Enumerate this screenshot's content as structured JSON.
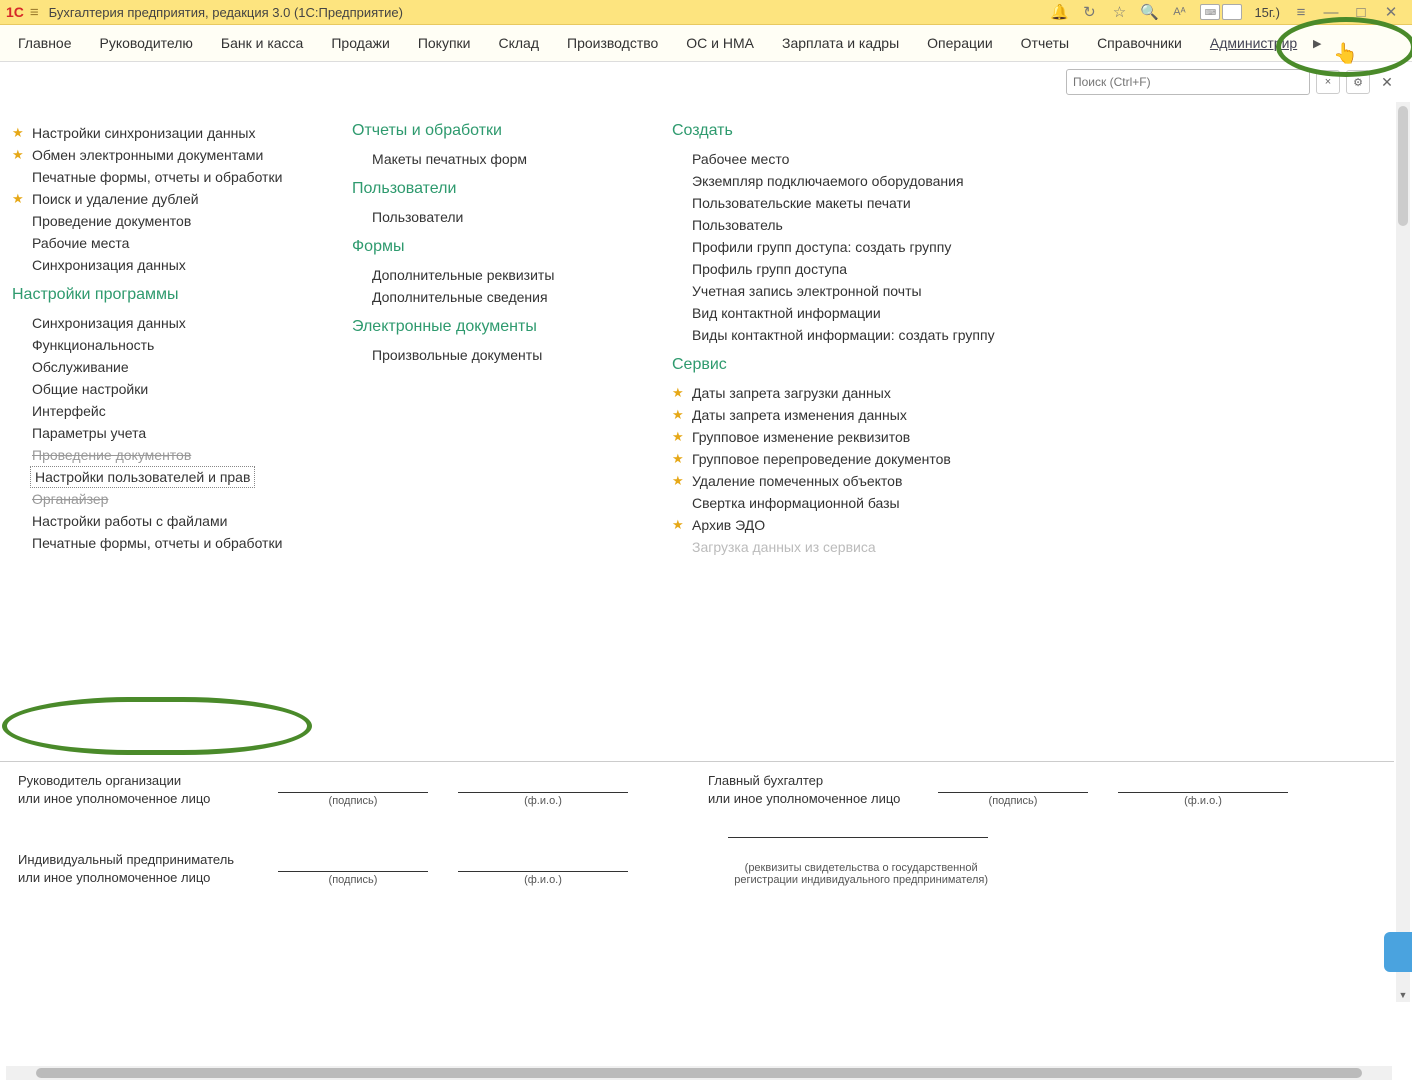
{
  "titlebar": {
    "logo": "1C",
    "title": "Бухгалтерия предприятия, редакция 3.0  (1С:Предприятие)",
    "cut_text": "15г.)"
  },
  "nav": {
    "items": [
      "Главное",
      "Руководителю",
      "Банк и касса",
      "Продажи",
      "Покупки",
      "Склад",
      "Производство",
      "ОС и НМА",
      "Зарплата и кадры",
      "Операции",
      "Отчеты",
      "Справочники"
    ],
    "last": "Администрир"
  },
  "search": {
    "placeholder": "Поиск (Ctrl+F)"
  },
  "columns": {
    "col1": {
      "top_items": [
        {
          "label": "Настройки синхронизации данных",
          "star": true
        },
        {
          "label": "Обмен электронными документами",
          "star": true
        },
        {
          "label": "Печатные формы, отчеты и обработки",
          "star": false
        },
        {
          "label": "Поиск и удаление дублей",
          "star": true
        },
        {
          "label": "Проведение документов",
          "star": false
        },
        {
          "label": "Рабочие места",
          "star": false
        },
        {
          "label": "Синхронизация данных",
          "star": false
        }
      ],
      "group1_title": "Настройки программы",
      "group1_items": [
        {
          "label": "Синхронизация данных"
        },
        {
          "label": "Функциональность"
        },
        {
          "label": "Обслуживание"
        },
        {
          "label": "Общие настройки"
        },
        {
          "label": "Интерфейс"
        },
        {
          "label": "Параметры учета"
        },
        {
          "label": "Проведение документов",
          "struck": true
        },
        {
          "label": "Настройки пользователей и прав",
          "boxed": true
        },
        {
          "label": "Органайзер",
          "struck": true
        },
        {
          "label": "Настройки работы с файлами"
        },
        {
          "label": "Печатные формы, отчеты и обработки"
        }
      ]
    },
    "col2": {
      "g1_title": "Отчеты и обработки",
      "g1_items": [
        {
          "label": "Макеты печатных форм"
        }
      ],
      "g2_title": "Пользователи",
      "g2_items": [
        {
          "label": "Пользователи"
        }
      ],
      "g3_title": "Формы",
      "g3_items": [
        {
          "label": "Дополнительные реквизиты"
        },
        {
          "label": "Дополнительные сведения"
        }
      ],
      "g4_title": "Электронные документы",
      "g4_items": [
        {
          "label": "Произвольные документы"
        }
      ]
    },
    "col3": {
      "g1_title": "Создать",
      "g1_items": [
        {
          "label": "Рабочее место"
        },
        {
          "label": "Экземпляр подключаемого оборудования"
        },
        {
          "label": "Пользовательские макеты печати"
        },
        {
          "label": "Пользователь"
        },
        {
          "label": "Профили групп доступа: создать группу"
        },
        {
          "label": "Профиль групп доступа"
        },
        {
          "label": "Учетная запись электронной почты"
        },
        {
          "label": "Вид контактной информации"
        },
        {
          "label": "Виды контактной информации: создать группу"
        }
      ],
      "g2_title": "Сервис",
      "g2_items": [
        {
          "label": "Даты запрета загрузки данных",
          "star": true
        },
        {
          "label": "Даты запрета изменения данных",
          "star": true
        },
        {
          "label": "Групповое изменение реквизитов",
          "star": true
        },
        {
          "label": "Групповое перепроведение документов",
          "star": true
        },
        {
          "label": "Удаление помеченных объектов",
          "star": true
        },
        {
          "label": "Свертка информационной базы"
        },
        {
          "label": "Архив ЭДО",
          "star": true
        },
        {
          "label": "Загрузка данных из сервиса",
          "cut": true
        }
      ]
    }
  },
  "footer": {
    "left1a": "Руководитель организации",
    "left1b": "или иное уполномоченное лицо",
    "right1a": "Главный бухгалтер",
    "right1b": "или иное уполномоченное лицо",
    "left2a": "Индивидуальный предприниматель",
    "left2b": "или иное уполномоченное лицо",
    "sig_podpis": "(подпись)",
    "sig_fio": "(ф.и.о.)",
    "note1": "(реквизиты свидетельства о государственной",
    "note2": "регистрации индивидуального предпринимателя)"
  }
}
